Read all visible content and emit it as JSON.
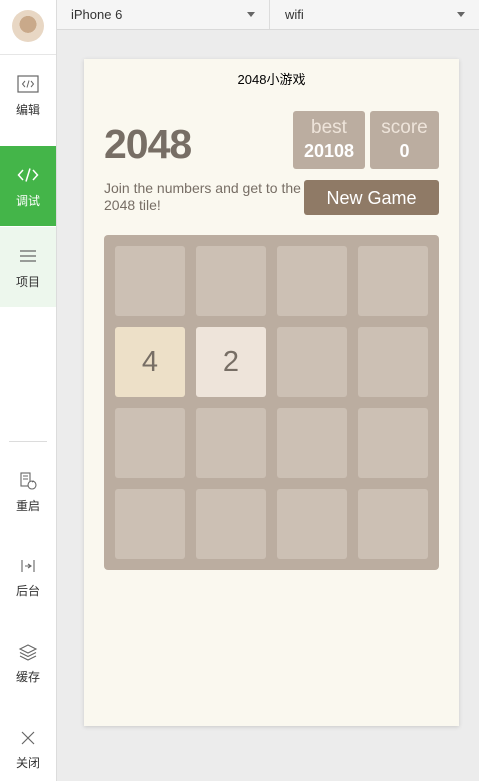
{
  "sidebar": {
    "items": [
      {
        "label": "编辑",
        "icon": "code-file-icon"
      },
      {
        "label": "调试",
        "icon": "code-brackets-icon"
      },
      {
        "label": "项目",
        "icon": "menu-lines-icon"
      }
    ],
    "tools": [
      {
        "label": "重启",
        "icon": "restart-icon"
      },
      {
        "label": "后台",
        "icon": "background-icon"
      },
      {
        "label": "缓存",
        "icon": "layers-icon"
      },
      {
        "label": "关闭",
        "icon": "close-icon"
      }
    ]
  },
  "topbar": {
    "device": "iPhone 6",
    "network": "wifi"
  },
  "app": {
    "nav_title": "2048小游戏",
    "game_title": "2048",
    "best_label": "best",
    "best_value": "20108",
    "score_label": "score",
    "score_value": "0",
    "intro_text": "Join the numbers and get to the 2048 tile!",
    "new_game_label": "New Game",
    "grid": [
      [
        "",
        "",
        "",
        ""
      ],
      [
        "4",
        "2",
        "",
        ""
      ],
      [
        "",
        "",
        "",
        ""
      ],
      [
        "",
        "",
        "",
        ""
      ]
    ]
  },
  "colors": {
    "accent": "#44b549",
    "board": "#bbada0",
    "button": "#8f7a66",
    "text": "#776e65",
    "tile2": "#eee4da",
    "tile4": "#ede0c8",
    "background": "#faf8ef"
  }
}
